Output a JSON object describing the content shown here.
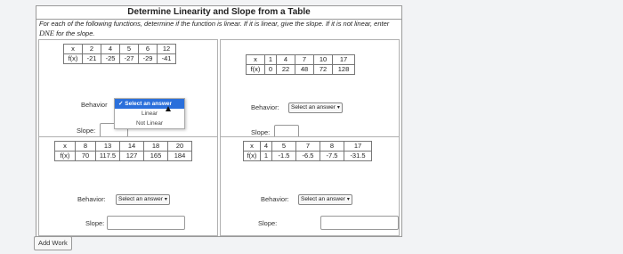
{
  "title": "Determine Linearity and Slope from a Table",
  "instructions": {
    "text": "For each of the following functions, determine if the function is linear. If it is linear, give the slope. If it is not linear, enter ",
    "emph": "DNE",
    "tail": " for the slope."
  },
  "quadrants": [
    {
      "x_label": "x",
      "fx_label": "f(x)",
      "x_values": [
        "2",
        "4",
        "5",
        "6",
        "12"
      ],
      "fx_values": [
        "-21",
        "-25",
        "-27",
        "-29",
        "-41"
      ],
      "behavior_label": "Behavior",
      "behavior_value": "Select an answer",
      "slope_label": "Slope:",
      "dropdown_options": [
        "Select an answer",
        "Linear",
        "Not Linear"
      ]
    },
    {
      "x_label": "x",
      "fx_label": "f(x)",
      "x_values": [
        "1",
        "4",
        "7",
        "10",
        "17"
      ],
      "fx_values": [
        "0",
        "22",
        "48",
        "72",
        "128"
      ],
      "behavior_label": "Behavior:",
      "behavior_value": "Select an answer",
      "slope_label": "Slope:"
    },
    {
      "x_label": "x",
      "fx_label": "f(x)",
      "x_values": [
        "8",
        "13",
        "14",
        "18",
        "20"
      ],
      "fx_values": [
        "70",
        "117.5",
        "127",
        "165",
        "184"
      ],
      "behavior_label": "Behavior:",
      "behavior_value": "Select an answer",
      "slope_label": "Slope:"
    },
    {
      "x_label": "x",
      "fx_label": "f(x)",
      "x_values": [
        "4",
        "5",
        "7",
        "8",
        "17"
      ],
      "fx_values": [
        "1",
        "-1.5",
        "-6.5",
        "-7.5",
        "-31.5"
      ],
      "behavior_label": "Behavior:",
      "behavior_value": "Select an answer",
      "slope_label": "Slope:"
    }
  ],
  "add_work_label": "Add Work",
  "colors": {
    "highlight": "#2a6fdb",
    "border": "#9a9a9a"
  }
}
